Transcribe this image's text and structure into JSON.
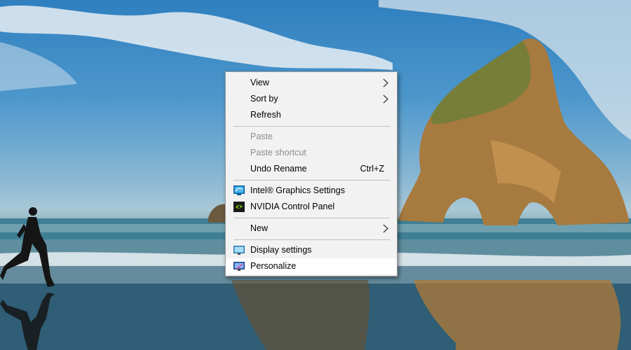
{
  "wallpaper": {
    "description_icon": "beach-rock-arch-wallpaper"
  },
  "context_menu": {
    "groups": [
      {
        "items": [
          {
            "label": "View",
            "submenu": true
          },
          {
            "label": "Sort by",
            "submenu": true
          },
          {
            "label": "Refresh"
          }
        ]
      },
      {
        "items": [
          {
            "label": "Paste",
            "disabled": true
          },
          {
            "label": "Paste shortcut",
            "disabled": true
          },
          {
            "label": "Undo Rename",
            "shortcut": "Ctrl+Z"
          }
        ]
      },
      {
        "items": [
          {
            "label": "Intel® Graphics Settings",
            "icon": "intel-graphics-icon"
          },
          {
            "label": "NVIDIA Control Panel",
            "icon": "nvidia-icon"
          }
        ]
      },
      {
        "items": [
          {
            "label": "New",
            "submenu": true
          }
        ]
      },
      {
        "items": [
          {
            "label": "Display settings",
            "icon": "display-settings-icon"
          },
          {
            "label": "Personalize",
            "icon": "personalize-icon",
            "highlighted": true
          }
        ]
      }
    ]
  },
  "colors": {
    "menu_background": "#f2f2f2",
    "menu_border": "#a0a0a0",
    "disabled_text": "#8d8d8d",
    "highlight": "#ffffff"
  }
}
